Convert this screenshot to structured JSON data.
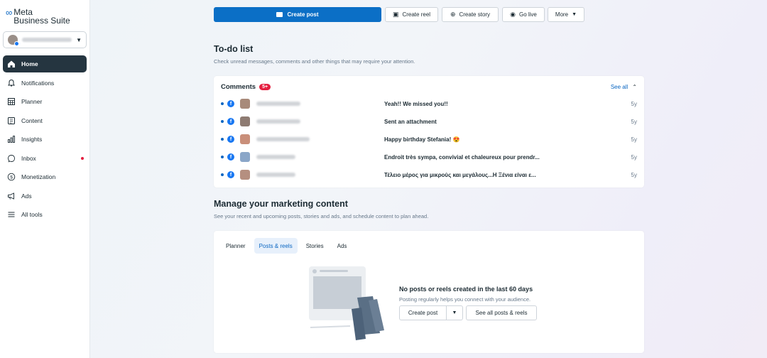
{
  "sidebar": {
    "logo_mark": "∞",
    "logo_line1": "Meta",
    "logo_line2": "Business Suite",
    "items": [
      {
        "label": "Home",
        "icon": "home-icon"
      },
      {
        "label": "Notifications",
        "icon": "bell-icon"
      },
      {
        "label": "Planner",
        "icon": "calendar-grid-icon"
      },
      {
        "label": "Content",
        "icon": "content-icon"
      },
      {
        "label": "Insights",
        "icon": "bar-chart-icon"
      },
      {
        "label": "Inbox",
        "icon": "chat-bubble-icon"
      },
      {
        "label": "Monetization",
        "icon": "dollar-circle-icon"
      },
      {
        "label": "Ads",
        "icon": "megaphone-icon"
      },
      {
        "label": "All tools",
        "icon": "menu-icon"
      }
    ]
  },
  "toolbar": {
    "create_post": "Create post",
    "create_reel": "Create reel",
    "create_story": "Create story",
    "go_live": "Go live",
    "more": "More"
  },
  "todo": {
    "title": "To-do list",
    "subtitle": "Check unread messages, comments and other things that may require your attention.",
    "comments_label": "Comments",
    "badge": "5+",
    "see_all": "See all",
    "comments": [
      {
        "text": "Yeah!! We missed you!!",
        "time": "5y"
      },
      {
        "text": "Sent an attachment",
        "time": "5y"
      },
      {
        "text": "Happy birthday Stefania! 😍",
        "time": "5y"
      },
      {
        "text": "Endroit très sympa, convivial et chaleureux pour prendr...",
        "time": "5y"
      },
      {
        "text": "Τέλειο μέρος για μικρούς και μεγάλους...Η Ξένια είναι ε...",
        "time": "5y"
      }
    ]
  },
  "marketing": {
    "title": "Manage your marketing content",
    "subtitle": "See your recent and upcoming posts, stories and ads, and schedule content to plan ahead.",
    "tabs": [
      "Planner",
      "Posts & reels",
      "Stories",
      "Ads"
    ],
    "active_tab": "Posts & reels",
    "empty_title": "No posts or reels created in the last 60 days",
    "empty_sub": "Posting regularly helps you connect with your audience.",
    "create_post": "Create post",
    "see_all": "See all posts & reels"
  },
  "colors": {
    "primary": "#0b6fc6",
    "active_nav": "#253540",
    "badge": "#e41e3f",
    "link": "#0a66c2"
  }
}
